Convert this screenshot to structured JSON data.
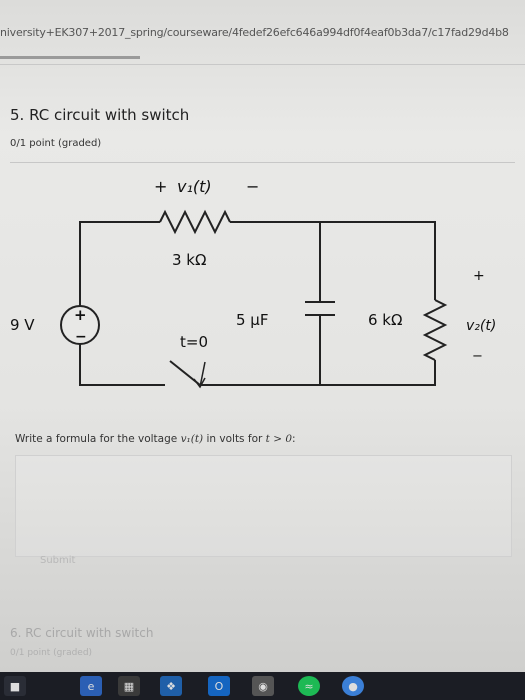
{
  "browser": {
    "url": "niversity+EK307+2017_spring/courseware/4fedef26efc646a994df0f4eaf0b3da7/c17fad29d4b8"
  },
  "problem": {
    "title": "5. RC circuit with switch",
    "points": "0/1 point (graded)"
  },
  "circuit": {
    "v1_label_plus": "+",
    "v1_label": "v₁(t)",
    "v1_label_minus": "−",
    "resistor1": "3 kΩ",
    "source": "9 V",
    "source_plus": "+",
    "source_minus": "−",
    "capacitor": "5 μF",
    "switch": "t=0",
    "resistor2": "6 kΩ",
    "v2_plus": "+",
    "v2_label": "v₂(t)",
    "v2_minus": "−"
  },
  "question": {
    "prefix": "Write a formula for the voltage ",
    "var": "v₁(t)",
    "middle": " in volts for ",
    "condition": "t > 0",
    "suffix": ":"
  },
  "submit": {
    "label": "Submit"
  },
  "next_problem": {
    "title": "6. RC circuit with switch",
    "points": "0/1 point (graded)"
  },
  "taskbar": {
    "icons": [
      "start-icon",
      "task-view-icon",
      "edge-icon",
      "store-icon",
      "dropbox-icon",
      "outlook-icon",
      "tripadvisor-icon",
      "spotify-icon",
      "chrome-icon"
    ]
  }
}
